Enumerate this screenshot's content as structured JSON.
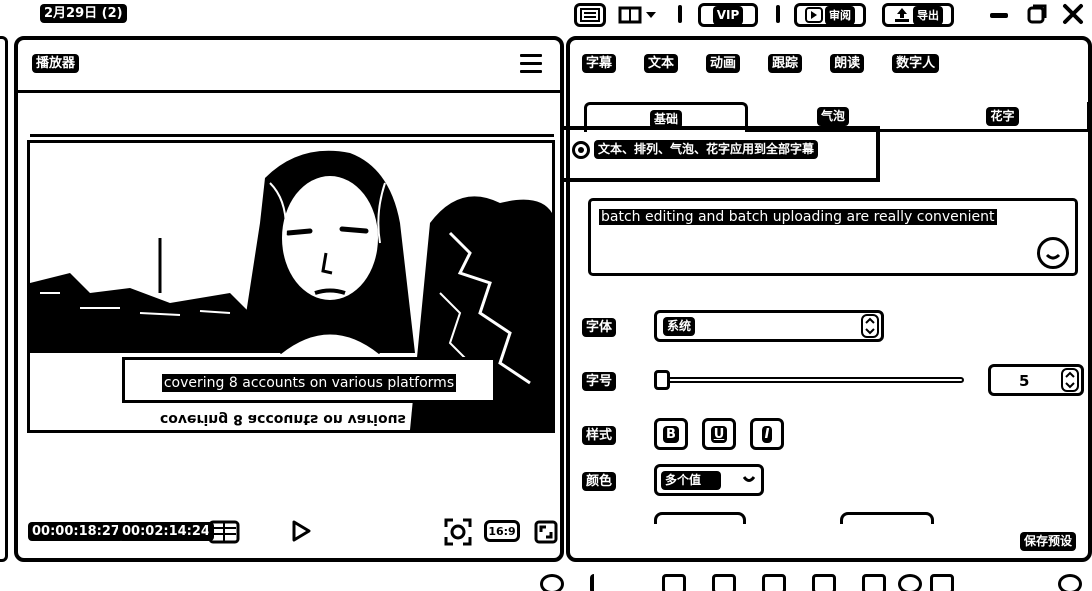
{
  "window": {
    "title": "2月29日 (2)",
    "vip_label": "VIP",
    "review_label": "审阅",
    "export_label": "导出"
  },
  "player": {
    "title": "播放器",
    "caption": "covering 8 accounts on various platforms",
    "caption_mirror": "covering 8 accounts on various platforms",
    "current_time": "00:00:18:27",
    "total_time": "00:02:14:24",
    "aspect_ratio": "16:9"
  },
  "properties": {
    "main_tabs": [
      "字幕",
      "文本",
      "动画",
      "跟踪",
      "朗读",
      "数字人"
    ],
    "sub_tabs": [
      "基础",
      "气泡",
      "花字"
    ],
    "apply_all_label": "文本、排列、气泡、花字应用到全部字幕",
    "text_value": "batch editing and batch uploading are really convenient",
    "font_label": "字体",
    "font_value": "系统",
    "size_label": "字号",
    "size_value": "5",
    "size_slider_fraction": 0.0,
    "style_label": "样式",
    "style_buttons": [
      "B",
      "U",
      "I"
    ],
    "color_label": "颜色",
    "color_value": "多个值",
    "save_preset_label": "保存预设"
  }
}
